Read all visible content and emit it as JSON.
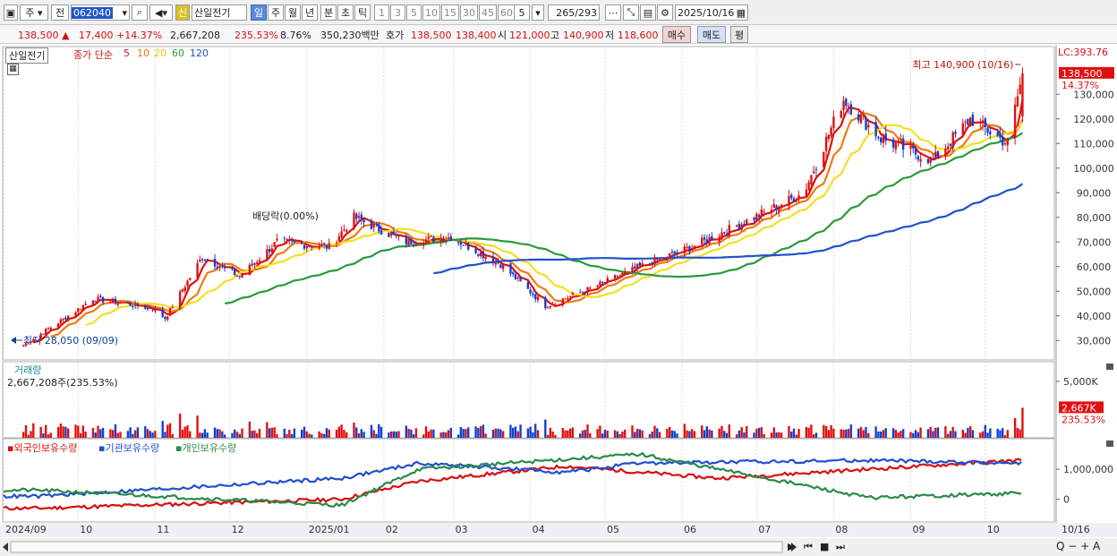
{
  "toolbar": {
    "market": "주",
    "kind": "전",
    "code": "062040",
    "badge": "신",
    "name": "산일전기",
    "periods": [
      "일",
      "주",
      "월",
      "년",
      "분",
      "초",
      "틱"
    ],
    "active_period": "일",
    "intervals": [
      "1",
      "3",
      "5",
      "10",
      "15",
      "30",
      "45",
      "60"
    ],
    "count": "5",
    "range": "265/293",
    "date": "2025/10/16"
  },
  "quote": {
    "price": "138,500",
    "arrow": "▲",
    "change": "17,400",
    "change_pct": "+14.37%",
    "volume": "2,667,208",
    "vol_ratio": "235.53%",
    "turnover_rate": "8.76%",
    "amount": "350,230백만",
    "hoga_label": "호가",
    "ask": "138,500",
    "bid": "138,400",
    "open_label": "시",
    "open": "121,000",
    "high_label": "고",
    "high": "140,900",
    "low_label": "저",
    "low": "118,600",
    "buy_button": "매수",
    "sell_button": "매도",
    "eval_button": "평"
  },
  "legend": {
    "stock": "산일전기",
    "ma_label": "종가 단순",
    "ma_periods": [
      "5",
      "10",
      "20",
      "60",
      "120"
    ],
    "ma_colors": [
      "#e01010",
      "#f07a10",
      "#f2e020",
      "#2a9a3a",
      "#2050d0"
    ]
  },
  "price_panel": {
    "lc": "LC:393.76",
    "current_tag": "138,500",
    "current_pct": "14.37%",
    "y_ticks": [
      "130,000",
      "120,000",
      "110,000",
      "100,000",
      "90,000",
      "80,000",
      "70,000",
      "60,000",
      "50,000",
      "40,000",
      "30,000"
    ],
    "max_annotation": "최고 140,900 (10/16)",
    "min_annotation": "최저 28,050 (09/09)",
    "dividend_annotation": "배당락(0.00%)"
  },
  "volume_panel": {
    "title": "거래량",
    "value": "2,667,208주(235.53%)",
    "y_tick": "5,000K",
    "current_tag": "2,667K",
    "current_pct": "235.53%"
  },
  "holdings_panel": {
    "series": [
      "외국인보유수량",
      "기관보유수량",
      "개인보유수량"
    ],
    "colors": [
      "#d81010",
      "#2050d0",
      "#2a8a4a"
    ],
    "y_ticks": [
      "1,000,000",
      "0"
    ]
  },
  "x_axis": {
    "labels": [
      "2024/09",
      "10",
      "11",
      "12",
      "2025/01",
      "02",
      "03",
      "04",
      "05",
      "06",
      "07",
      "08",
      "09",
      "10"
    ],
    "last_date": "10/16"
  },
  "chart_data": {
    "type": "candlestick",
    "title": "산일전기",
    "x_months": [
      "2024/09",
      "10",
      "11",
      "12",
      "2025/01",
      "02",
      "03",
      "04",
      "05",
      "06",
      "07",
      "08",
      "09",
      "10"
    ],
    "close_approx": [
      [
        "2024-09-09",
        28050
      ],
      [
        "2024-09-30",
        42000
      ],
      [
        "2024-10-07",
        47000
      ],
      [
        "2024-10-31",
        43000
      ],
      [
        "2024-11-05",
        39000
      ],
      [
        "2024-11-20",
        64000
      ],
      [
        "2024-12-05",
        56000
      ],
      [
        "2024-12-20",
        70000
      ],
      [
        "2025-01-10",
        68000
      ],
      [
        "2025-01-20",
        80000
      ],
      [
        "2025-02-10",
        70000
      ],
      [
        "2025-02-28",
        72000
      ],
      [
        "2025-03-20",
        61000
      ],
      [
        "2025-04-07",
        44000
      ],
      [
        "2025-04-25",
        51000
      ],
      [
        "2025-05-15",
        60000
      ],
      [
        "2025-06-05",
        68000
      ],
      [
        "2025-06-30",
        80000
      ],
      [
        "2025-07-20",
        90000
      ],
      [
        "2025-08-05",
        128000
      ],
      [
        "2025-08-20",
        112000
      ],
      [
        "2025-09-10",
        103000
      ],
      [
        "2025-09-25",
        120000
      ],
      [
        "2025-10-10",
        110000
      ],
      [
        "2025-10-16",
        138500
      ]
    ],
    "ohlc_last": {
      "open": 121000,
      "high": 140900,
      "low": 118600,
      "close": 138500
    },
    "y_range": [
      25000,
      145000
    ],
    "volume_max_k": 5000,
    "volume_last_k": 2667,
    "holdings": {
      "foreign": [
        [
          "2024-09",
          -300000
        ],
        [
          "2025-01",
          0
        ],
        [
          "2025-02",
          600000
        ],
        [
          "2025-04",
          1100000
        ],
        [
          "2025-06",
          700000
        ],
        [
          "2025-08",
          1000000
        ],
        [
          "2025-10",
          1300000
        ]
      ],
      "institution": [
        [
          "2024-09",
          100000
        ],
        [
          "2025-01",
          700000
        ],
        [
          "2025-02",
          1200000
        ],
        [
          "2025-04",
          900000
        ],
        [
          "2025-05",
          1200000
        ],
        [
          "2025-08",
          1300000
        ],
        [
          "2025-10",
          1200000
        ]
      ],
      "individual": [
        [
          "2024-09",
          300000
        ],
        [
          "2025-01",
          -200000
        ],
        [
          "2025-02",
          1000000
        ],
        [
          "2025-05",
          1500000
        ],
        [
          "2025-08",
          50000
        ],
        [
          "2025-10",
          200000
        ]
      ]
    }
  }
}
